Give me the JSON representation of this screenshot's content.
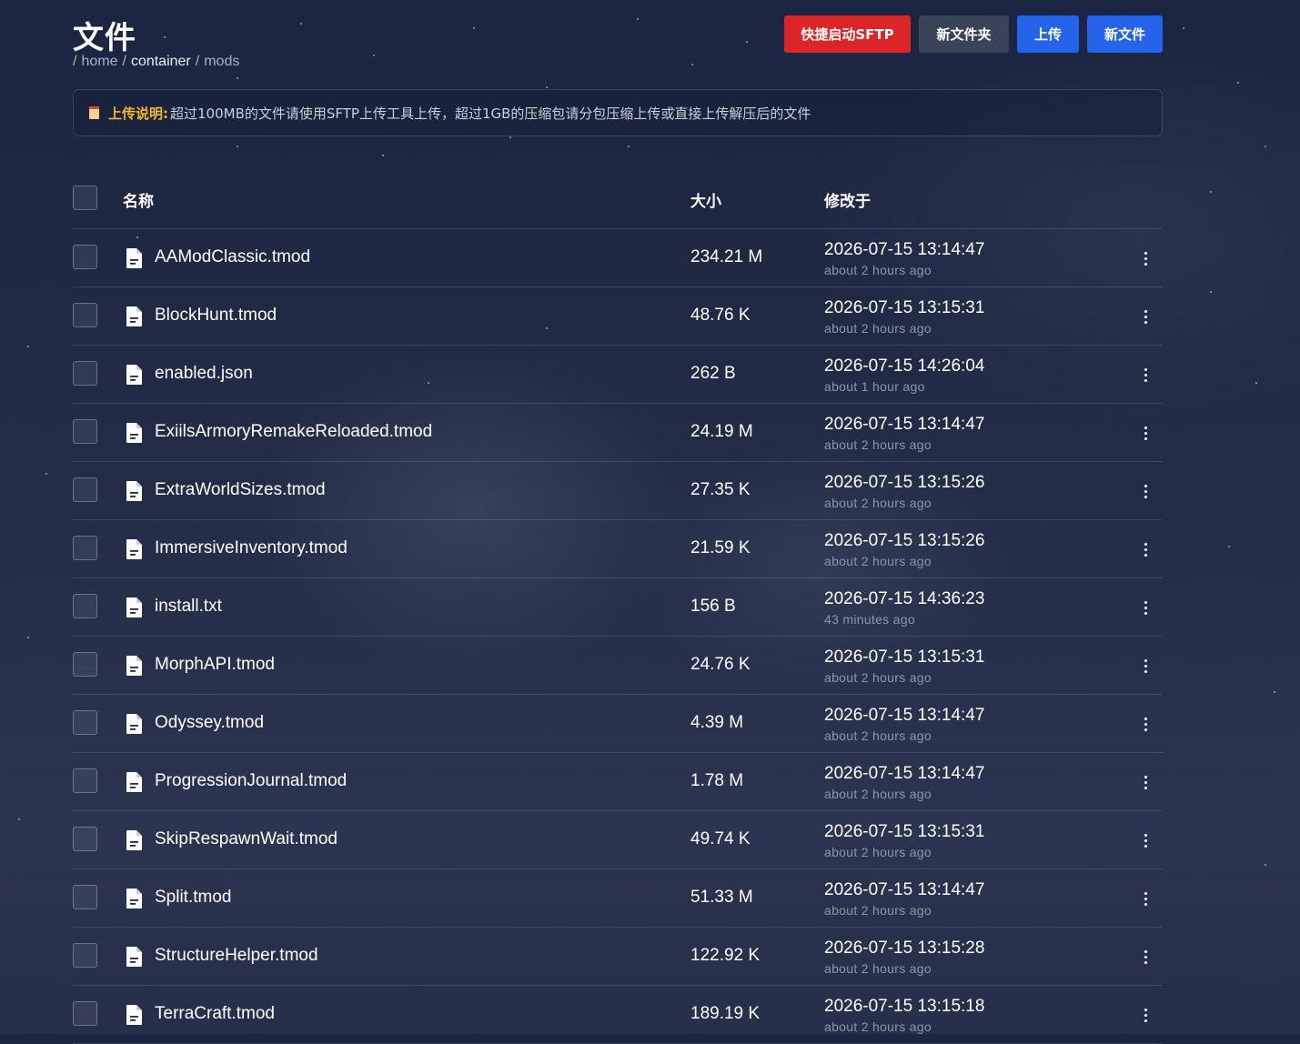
{
  "page": {
    "title": "文件",
    "breadcrumb": [
      {
        "label": "home",
        "bright": false
      },
      {
        "label": "container",
        "bright": true
      },
      {
        "label": "mods",
        "bright": false
      }
    ],
    "breadcrumb_separator": "/"
  },
  "actions": {
    "sftp_label": "快捷启动SFTP",
    "new_folder_label": "新文件夹",
    "upload_label": "上传",
    "new_file_label": "新文件"
  },
  "notice": {
    "icon": "clipboard-icon",
    "label": "上传说明:",
    "text": "超过100MB的文件请使用SFTP上传工具上传，超过1GB的压缩包请分包压缩上传或直接上传解压后的文件"
  },
  "table": {
    "headers": {
      "name": "名称",
      "size": "大小",
      "modified": "修改于"
    },
    "rows": [
      {
        "name": "AAModClassic.tmod",
        "size": "234.21 M",
        "date": "2026-07-15 13:14:47",
        "relative": "about 2 hours ago"
      },
      {
        "name": "BlockHunt.tmod",
        "size": "48.76 K",
        "date": "2026-07-15 13:15:31",
        "relative": "about 2 hours ago"
      },
      {
        "name": "enabled.json",
        "size": "262 B",
        "date": "2026-07-15 14:26:04",
        "relative": "about 1 hour ago"
      },
      {
        "name": "ExiilsArmoryRemakeReloaded.tmod",
        "size": "24.19 M",
        "date": "2026-07-15 13:14:47",
        "relative": "about 2 hours ago"
      },
      {
        "name": "ExtraWorldSizes.tmod",
        "size": "27.35 K",
        "date": "2026-07-15 13:15:26",
        "relative": "about 2 hours ago"
      },
      {
        "name": "ImmersiveInventory.tmod",
        "size": "21.59 K",
        "date": "2026-07-15 13:15:26",
        "relative": "about 2 hours ago"
      },
      {
        "name": "install.txt",
        "size": "156 B",
        "date": "2026-07-15 14:36:23",
        "relative": "43 minutes ago"
      },
      {
        "name": "MorphAPI.tmod",
        "size": "24.76 K",
        "date": "2026-07-15 13:15:31",
        "relative": "about 2 hours ago"
      },
      {
        "name": "Odyssey.tmod",
        "size": "4.39 M",
        "date": "2026-07-15 13:14:47",
        "relative": "about 2 hours ago"
      },
      {
        "name": "ProgressionJournal.tmod",
        "size": "1.78 M",
        "date": "2026-07-15 13:14:47",
        "relative": "about 2 hours ago"
      },
      {
        "name": "SkipRespawnWait.tmod",
        "size": "49.74 K",
        "date": "2026-07-15 13:15:31",
        "relative": "about 2 hours ago"
      },
      {
        "name": "Split.tmod",
        "size": "51.33 M",
        "date": "2026-07-15 13:14:47",
        "relative": "about 2 hours ago"
      },
      {
        "name": "StructureHelper.tmod",
        "size": "122.92 K",
        "date": "2026-07-15 13:15:28",
        "relative": "about 2 hours ago"
      },
      {
        "name": "TerraCraft.tmod",
        "size": "189.19 K",
        "date": "2026-07-15 13:15:18",
        "relative": "about 2 hours ago"
      }
    ]
  },
  "icons": {
    "file": "file-icon",
    "row_menu": "more-vertical-icon"
  },
  "colors": {
    "danger": "#dc2526",
    "primary": "#2563eb",
    "secondary": "#3a4458",
    "notice_label": "#f5b82e"
  }
}
